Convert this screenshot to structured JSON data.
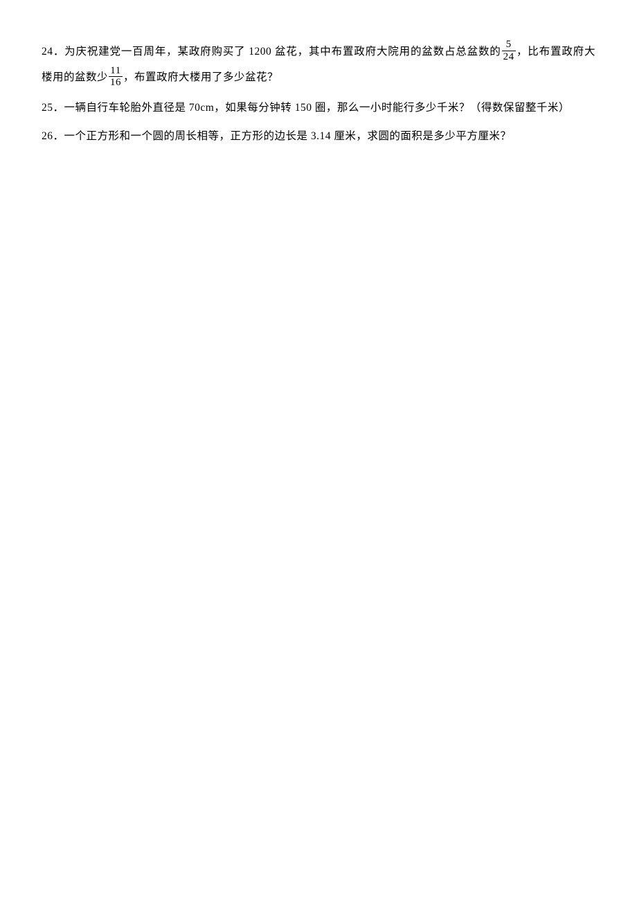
{
  "questions": {
    "q24": {
      "number": "24",
      "text_part1": "．为庆祝建党一百周年，某政府购买了 1200 盆花，其中布置政府大院用的盆数占总盆数的",
      "frac1_num": "5",
      "frac1_den": "24",
      "text_part2": "，比布置政府大楼用的盆数少",
      "frac2_num": "11",
      "frac2_den": "16",
      "text_part3": "，布置政府大楼用了多少盆花？"
    },
    "q25": {
      "number": "25",
      "text": "．一辆自行车轮胎外直径是 70cm，如果每分钟转 150 圈，那么一小时能行多少千米？（得数保留整千米）"
    },
    "q26": {
      "number": "26",
      "text": "．一个正方形和一个圆的周长相等，正方形的边长是 3.14 厘米，求圆的面积是多少平方厘米？"
    }
  }
}
